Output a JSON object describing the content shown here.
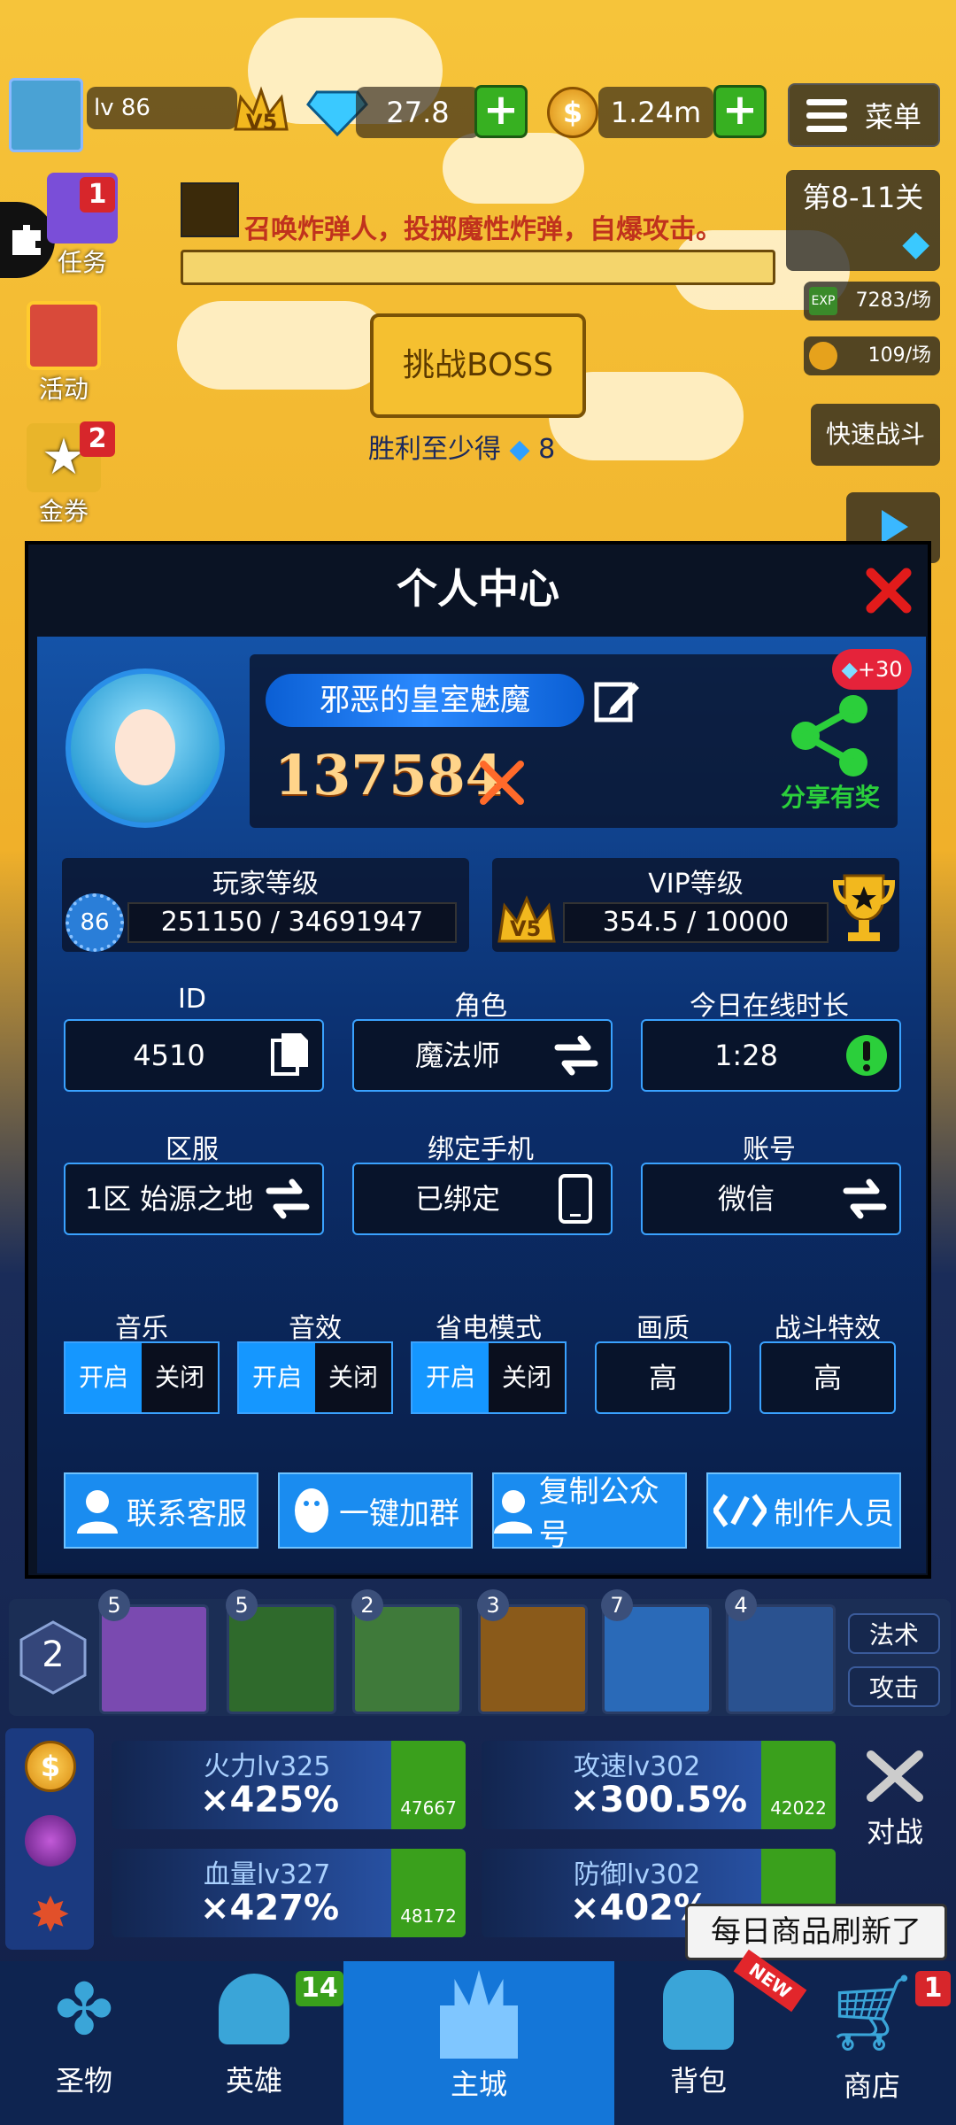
{
  "hud": {
    "level": "lv 86",
    "vip": "V5",
    "gems": "27.8",
    "gold": "1.24m",
    "menu_label": "菜单"
  },
  "side_left": {
    "task_label": "任务",
    "task_badge": "1",
    "activity_label": "活动",
    "coupon_label": "金券",
    "coupon_badge": "2"
  },
  "boss_banner": {
    "message": "召唤炸弹人，投掷魔性炸弹，自爆攻击。",
    "challenge_label": "挑战BOSS",
    "reward_text": "胜利至少得",
    "reward_amount": "8"
  },
  "side_right": {
    "stage": "第8-11关",
    "exp_rate": "7283/场",
    "gold_rate": "109/场",
    "quick_battle": "快速战斗"
  },
  "modal": {
    "title": "个人中心",
    "player_name": "邪恶的皇室魅魔",
    "power": "137584",
    "share_label": "分享有奖",
    "share_bonus": "+30",
    "player_level_title": "玩家等级",
    "player_level_badge": "86",
    "player_level_progress": "251150 / 34691947",
    "vip_title": "VIP等级",
    "vip_badge": "V5",
    "vip_progress": "354.5 / 10000",
    "fields": {
      "id_label": "ID",
      "id_value": "4510",
      "role_label": "角色",
      "role_value": "魔法师",
      "online_label": "今日在线时长",
      "online_value": "1:28",
      "server_label": "区服",
      "server_value": "1区 始源之地",
      "phone_label": "绑定手机",
      "phone_value": "已绑定",
      "account_label": "账号",
      "account_value": "微信"
    },
    "settings": {
      "music_label": "音乐",
      "sfx_label": "音效",
      "power_save_label": "省电模式",
      "quality_label": "画质",
      "effects_label": "战斗特效",
      "on": "开启",
      "off": "关闭",
      "quality_value": "高",
      "effects_value": "高"
    },
    "buttons": {
      "support": "联系客服",
      "join_group": "一键加群",
      "copy_account": "复制公众号",
      "credits": "制作人员"
    }
  },
  "bottom": {
    "skill_level": "2",
    "skill_counts": [
      "5",
      "5",
      "2",
      "3",
      "7",
      "4"
    ],
    "magic_label": "法术",
    "attack_label": "攻击",
    "stats": [
      {
        "title": "火力lv325",
        "value": "×425%",
        "cost": "47667"
      },
      {
        "title": "攻速lv302",
        "value": "×300.5%",
        "cost": "42022"
      },
      {
        "title": "血量lv327",
        "value": "×427%",
        "cost": "48172"
      },
      {
        "title": "防御lv302",
        "value": "×402%",
        "cost": ""
      }
    ],
    "battle_label": "对战",
    "toast": "每日商品刷新了"
  },
  "tabs": {
    "relic": "圣物",
    "hero": "英雄",
    "hero_badge": "14",
    "city": "主城",
    "bag": "背包",
    "bag_new": "NEW",
    "shop": "商店",
    "shop_badge": "1"
  }
}
